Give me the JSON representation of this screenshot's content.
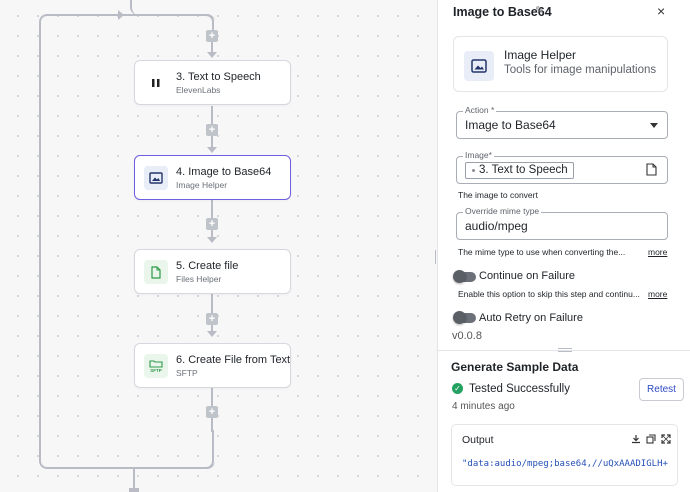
{
  "canvas": {
    "nodes": [
      {
        "title": "3. Text to Speech",
        "subtitle": "ElevenLabs",
        "icon": "pause-icon"
      },
      {
        "title": "4. Image to Base64",
        "subtitle": "Image Helper",
        "icon": "image-icon"
      },
      {
        "title": "5. Create file",
        "subtitle": "Files Helper",
        "icon": "file-icon"
      },
      {
        "title": "6. Create File from Text",
        "subtitle": "SFTP",
        "icon": "sftp-folder-icon",
        "icon_text": "SFTP"
      }
    ],
    "add_step_label": "+"
  },
  "panel": {
    "title": "Image to Base64",
    "close_label": "×",
    "helper": {
      "name": "Image Helper",
      "description": "Tools for image manipulations"
    },
    "action": {
      "label": "Action *",
      "value": "Image to Base64"
    },
    "image": {
      "label": "Image*",
      "chip": "3. Text to Speech",
      "help": "The image to convert"
    },
    "mime": {
      "label": "Override mime type",
      "value": "audio/mpeg",
      "help": "The mime type to use when converting the...",
      "more": "more"
    },
    "continue_on_failure": {
      "label": "Continue on Failure",
      "help": "Enable this option to skip this step and continu...",
      "more": "more",
      "enabled": false
    },
    "auto_retry": {
      "label": "Auto Retry on Failure",
      "enabled": false
    },
    "version": "v0.0.8"
  },
  "sample": {
    "title": "Generate Sample Data",
    "status": "Tested Successfully",
    "time_ago": "4 minutes ago",
    "retest_label": "Retest",
    "output_label": "Output",
    "output_preview": "\"data:audio/mpeg;base64,//uQxAAADIGLH+"
  },
  "colors": {
    "accent": "#6e5ee0",
    "link": "#2e49c7",
    "success": "#23a160",
    "code": "#2551b9"
  }
}
